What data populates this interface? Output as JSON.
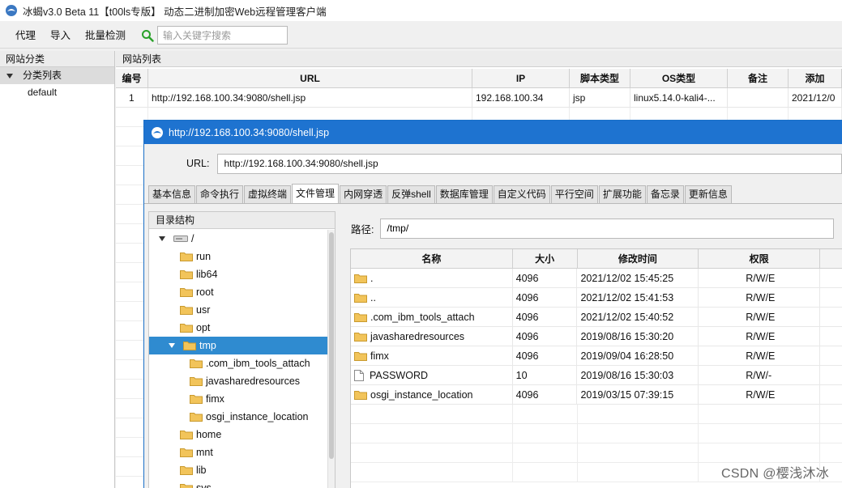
{
  "window": {
    "title": "冰蝎v3.0 Beta 11【t00ls专版】 动态二进制加密Web远程管理客户端"
  },
  "toolbar": {
    "proxy_label": "代理",
    "import_label": "导入",
    "batch_label": "批量检测",
    "search_placeholder": "输入关键字搜索"
  },
  "left_panel": {
    "header": "网站分类",
    "root_label": "分类列表",
    "children": [
      "default"
    ]
  },
  "site_list": {
    "header": "网站列表",
    "columns": [
      "编号",
      "URL",
      "IP",
      "脚本类型",
      "OS类型",
      "备注",
      "添加"
    ],
    "rows": [
      {
        "num": "1",
        "url": "http://192.168.100.34:9080/shell.jsp",
        "ip": "192.168.100.34",
        "script": "jsp",
        "os": "linux5.14.0-kali4-...",
        "note": "",
        "added": "2021/12/0"
      }
    ]
  },
  "shell": {
    "title": "http://192.168.100.34:9080/shell.jsp",
    "url_label": "URL:",
    "url_value": "http://192.168.100.34:9080/shell.jsp",
    "tabs": [
      "基本信息",
      "命令执行",
      "虚拟终端",
      "文件管理",
      "内网穿透",
      "反弹shell",
      "数据库管理",
      "自定义代码",
      "平行空间",
      "扩展功能",
      "备忘录",
      "更新信息"
    ],
    "active_tab": "文件管理",
    "dir_header": "目录结构",
    "path_label": "路径:",
    "path_value": "/tmp/",
    "tree": {
      "root": "/",
      "level1": [
        "run",
        "lib64",
        "root",
        "usr",
        "opt"
      ],
      "selected": "tmp",
      "tmp_children": [
        ".com_ibm_tools_attach",
        "javasharedresources",
        "fimx",
        "osgi_instance_location"
      ],
      "level1_after": [
        "home",
        "mnt",
        "lib",
        "sys"
      ]
    },
    "file_columns": [
      "名称",
      "大小",
      "修改时间",
      "权限"
    ],
    "files": [
      {
        "name": ".",
        "size": "4096",
        "mtime": "2021/12/02 15:45:25",
        "perm": "R/W/E",
        "type": "folder"
      },
      {
        "name": "..",
        "size": "4096",
        "mtime": "2021/12/02 15:41:53",
        "perm": "R/W/E",
        "type": "folder"
      },
      {
        "name": ".com_ibm_tools_attach",
        "size": "4096",
        "mtime": "2021/12/02 15:40:52",
        "perm": "R/W/E",
        "type": "folder"
      },
      {
        "name": "javasharedresources",
        "size": "4096",
        "mtime": "2019/08/16 15:30:20",
        "perm": "R/W/E",
        "type": "folder"
      },
      {
        "name": "fimx",
        "size": "4096",
        "mtime": "2019/09/04 16:28:50",
        "perm": "R/W/E",
        "type": "folder"
      },
      {
        "name": "PASSWORD",
        "size": "10",
        "mtime": "2019/08/16 15:30:03",
        "perm": "R/W/-",
        "type": "file"
      },
      {
        "name": "osgi_instance_location",
        "size": "4096",
        "mtime": "2019/03/15 07:39:15",
        "perm": "R/W/E",
        "type": "folder"
      }
    ]
  },
  "watermark": "CSDN @樱浅沐冰",
  "colors": {
    "title_bar_blue": "#1e73d0",
    "selection_blue": "#2f8bd0",
    "folder_yellow": "#f2c45a",
    "search_green": "#2aa12a"
  }
}
